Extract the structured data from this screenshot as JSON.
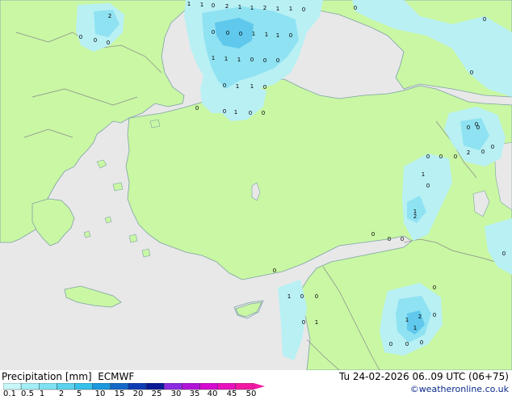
{
  "legend": {
    "title": "Precipitation [mm]",
    "model": "ECMWF",
    "levels": [
      "0.1",
      "0.5",
      "1",
      "2",
      "5",
      "10",
      "15",
      "20",
      "25",
      "30",
      "35",
      "40",
      "45",
      "50"
    ],
    "colors": [
      "#c7f7f8",
      "#a3eef5",
      "#7fe2f2",
      "#5bd2ee",
      "#37c0ea",
      "#1c98dc",
      "#1468c8",
      "#0c3cb4",
      "#0a1a96",
      "#8a2be2",
      "#b015d8",
      "#d40ad0",
      "#e812bd",
      "#f21aa3"
    ]
  },
  "valid_time": "Tu 24-02-2026 06..09 UTC (06+75)",
  "credit": "©weatheronline.co.uk",
  "colors": {
    "land": "#c9f7a4",
    "sea": "#e8e8e8",
    "border": "#8a8a8a",
    "coast": "#7fa1a6",
    "precip_light": "#b8f0f4",
    "precip_mid": "#8fe2f2",
    "precip_heavy": "#5fc8ec"
  },
  "grid_values": [
    "1",
    "1",
    "0",
    "2",
    "1",
    "1",
    "2",
    "1",
    "1",
    "0",
    "0",
    "2",
    "0",
    "0",
    "0",
    "0",
    "0",
    "0",
    "1",
    "1",
    "1",
    "0",
    "1",
    "1",
    "1",
    "0",
    "0",
    "0",
    "0",
    "1",
    "1",
    "0",
    "0",
    "0",
    "1",
    "0",
    "0",
    "0",
    "0",
    "0",
    "1",
    "2",
    "0",
    "1",
    "0",
    "0",
    "0",
    "0",
    "0",
    "0",
    "2",
    "0",
    "0",
    "0",
    "0",
    "0",
    "0",
    "1",
    "0",
    "0",
    "0",
    "1",
    "1",
    "2",
    "0",
    "1",
    "0",
    "0",
    "0",
    "0"
  ]
}
